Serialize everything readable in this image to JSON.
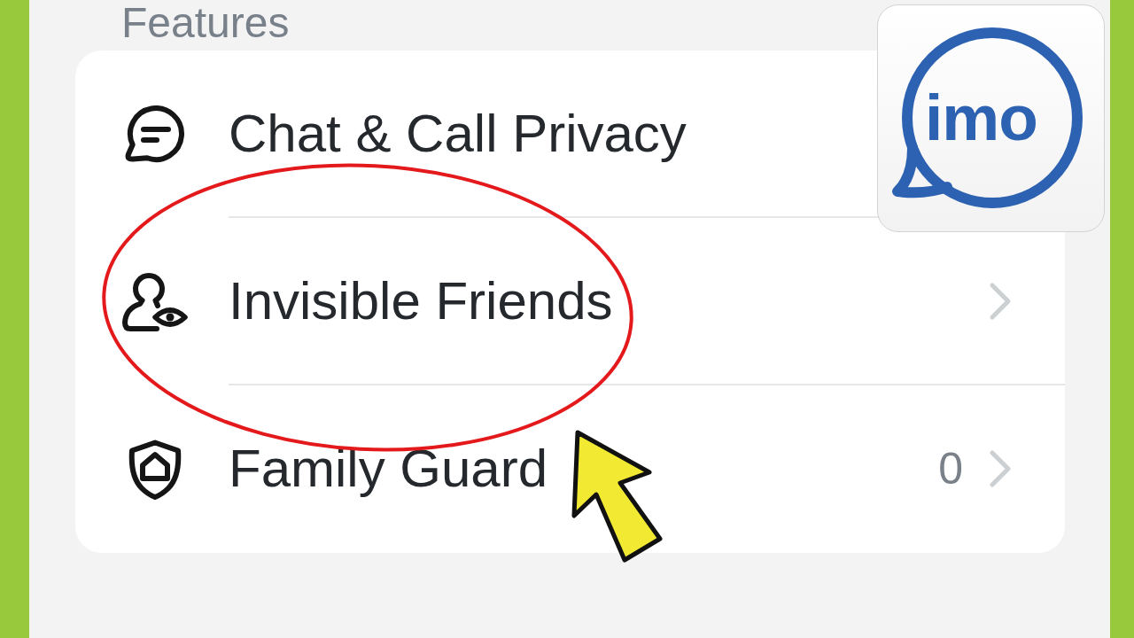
{
  "section_header": "Features",
  "rows": [
    {
      "label": "Chat & Call Privacy",
      "chevron": false,
      "circled": false
    },
    {
      "label": "Invisible Friends",
      "chevron": true,
      "circled": true
    },
    {
      "label": "Family Guard",
      "count": "0",
      "chevron": true,
      "circled": false
    }
  ],
  "logo": {
    "text": "imo"
  }
}
